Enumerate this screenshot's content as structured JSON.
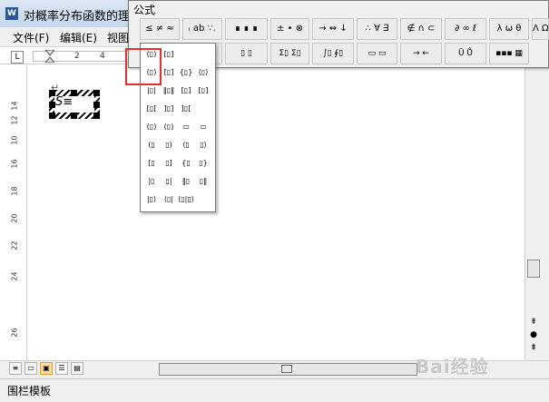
{
  "window": {
    "title": "对概率分布函数的理",
    "app_icon": "word-icon"
  },
  "menu": [
    {
      "label": "文件(F)"
    },
    {
      "label": "编辑(E)"
    },
    {
      "label": "视图"
    }
  ],
  "ruler": {
    "tab_symbol": "L",
    "numbers": [
      "2",
      "4"
    ]
  },
  "vruler_numbers": [
    "14",
    "12",
    "10",
    "16",
    "18",
    "20",
    "22",
    "24",
    "26"
  ],
  "document": {
    "paragraph_mark": "↵",
    "frame_glyph": "S≡",
    "frame_glyph_label": "S-l"
  },
  "equation_toolbar": {
    "title": "公式",
    "row1": [
      "≤ ≠ ≈",
      "ᵢ ab ∵.",
      "∎ ∎ ∎",
      "± • ⊗",
      "→ ⇔ ↓",
      "∴ ∀ ∃",
      "∉ ∩ ⊂",
      "∂ ∞ ℓ",
      "λ ω θ",
      "Λ Ω ⊕"
    ],
    "row2": [
      "(▯) [▯]",
      "▯/▯ √▯",
      "▯ ▯",
      "Σ▯ Σ▯",
      "∫▯ ∮▯",
      "▭ ▭",
      "→ ←",
      "Ū Ů",
      "▪▪▪ ▦"
    ]
  },
  "palette": {
    "items": [
      [
        "(▯)",
        "[▯]",
        "",
        ""
      ],
      [
        "(▯)",
        "[▯]",
        "{▯}",
        "⟨▯⟩"
      ],
      [
        "|▯|",
        "‖▯‖",
        "[▯]",
        "[▯]"
      ],
      [
        "[▯[",
        "]▯]",
        "]▯[",
        ""
      ],
      [
        "(▯)",
        "(▯)",
        "▭",
        "▭"
      ],
      [
        "(▯",
        "▯)",
        "⟨▯",
        "▯⟩"
      ],
      [
        "[▯",
        "▯]",
        "{▯",
        "▯}"
      ],
      [
        "|▯",
        "▯|",
        "‖▯",
        "▯‖"
      ],
      [
        "|▯⟩",
        "⟨▯|",
        "⟨▯|▯⟩",
        ""
      ]
    ]
  },
  "statusbar": {
    "text": "围栏模板"
  },
  "watermark": "Bai经验"
}
